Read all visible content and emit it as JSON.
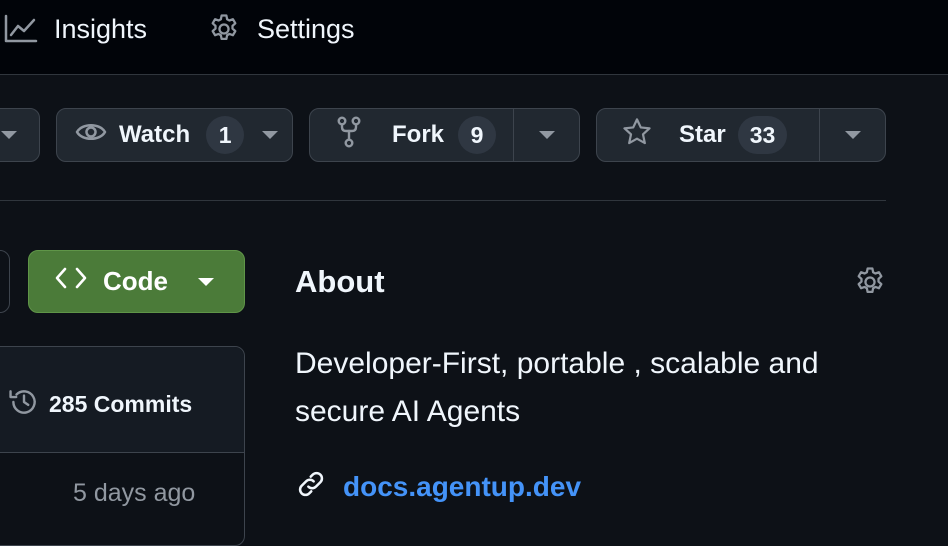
{
  "nav": {
    "insights_label": "Insights",
    "settings_label": "Settings"
  },
  "repo_actions": {
    "watch": {
      "label": "Watch",
      "count": "1"
    },
    "fork": {
      "label": "Fork",
      "count": "9"
    },
    "star": {
      "label": "Star",
      "count": "33"
    }
  },
  "code_button": {
    "label": "Code"
  },
  "commits": {
    "label": "285 Commits",
    "last_updated": "5 days ago"
  },
  "about": {
    "title": "About",
    "description": "Developer-First, portable , scalable and secure AI Agents",
    "link": "docs.agentup.dev"
  },
  "colors": {
    "page_bg": "#0d1117",
    "topbar_bg": "#010409",
    "button_bg": "#212830",
    "code_button_bg": "#4b7b39",
    "link": "#4493f8"
  }
}
